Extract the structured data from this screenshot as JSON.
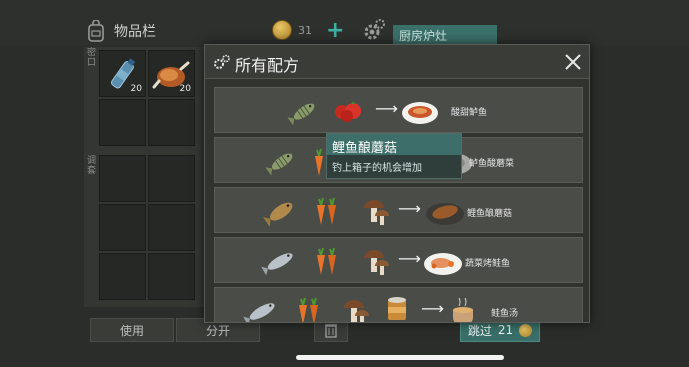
{
  "inventory": {
    "title": "物品栏",
    "coins": "31",
    "kitchen_tab": "厨房炉灶",
    "side_label_top": "密口",
    "side_label_mid": "调套",
    "slot_counts": [
      "20",
      "20"
    ],
    "use_label": "使用",
    "split_label": "分开",
    "skip_label": "跳过",
    "skip_cost": "21"
  },
  "modal": {
    "title": "所有配方",
    "recipes": [
      {
        "name": "酸甜鲈鱼"
      },
      {
        "name": "鲈鱼酸蘑菜"
      },
      {
        "name": "鲤鱼酿蘑菇"
      },
      {
        "name": "蔬菜烤鲑鱼"
      },
      {
        "name": "鲑鱼汤"
      }
    ]
  },
  "tooltip": {
    "title": "鲤鱼酿蘑菇",
    "description": "钓上箱子的机会增加"
  },
  "colors": {
    "accent": "#3b6f6a",
    "modal_bg": "#31332f",
    "row_bg": "#4a4c48"
  }
}
